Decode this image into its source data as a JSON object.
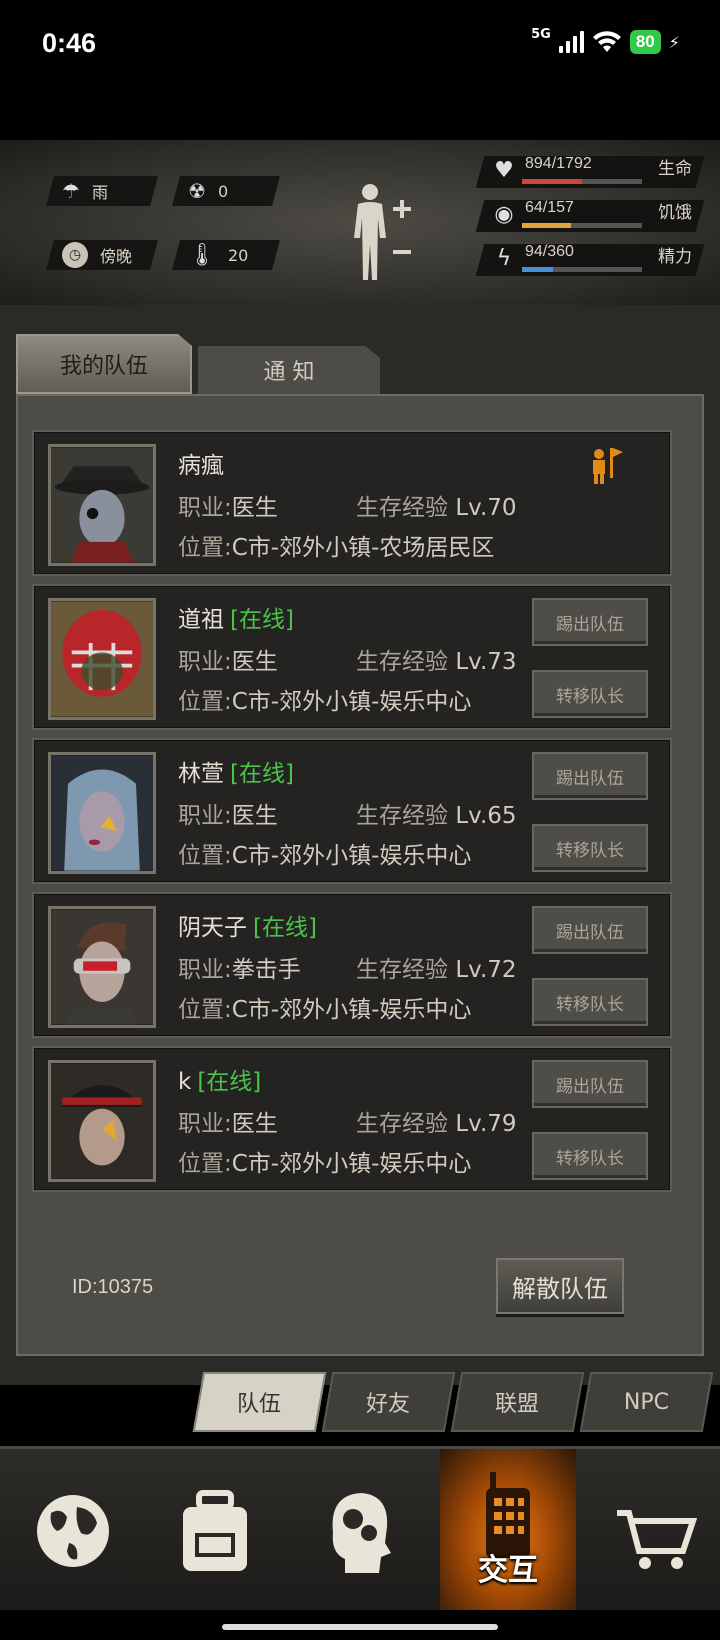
{
  "status_bar": {
    "time": "0:46",
    "network": "5G",
    "battery": "80"
  },
  "env": {
    "weather": "雨",
    "radiation": "0",
    "time_of_day": "傍晚",
    "temperature": "20"
  },
  "vitals": [
    {
      "label": "生命",
      "value": "894/1792",
      "fraction": 0.499,
      "color": "#d0453a"
    },
    {
      "label": "饥饿",
      "value": "64/157",
      "fraction": 0.408,
      "color": "#e0a63a"
    },
    {
      "label": "精力",
      "value": "94/360",
      "fraction": 0.261,
      "color": "#4a8fd6"
    }
  ],
  "tabs": {
    "mine": "我的队伍",
    "notice": "通 知"
  },
  "members": [
    {
      "name": "病瘋",
      "online": "",
      "job_label": "职业:",
      "job": "医生",
      "exp_label": "生存经验",
      "level": "Lv.70",
      "loc_label": "位置:",
      "location": "C市-郊外小镇-农场居民区",
      "is_leader": true
    },
    {
      "name": "道祖",
      "online": "[在线]",
      "job_label": "职业:",
      "job": "医生",
      "exp_label": "生存经验",
      "level": "Lv.73",
      "loc_label": "位置:",
      "location": "C市-郊外小镇-娱乐中心",
      "kick": "踢出队伍",
      "transfer": "转移队长"
    },
    {
      "name": "林萱",
      "online": "[在线]",
      "job_label": "职业:",
      "job": "医生",
      "exp_label": "生存经验",
      "level": "Lv.65",
      "loc_label": "位置:",
      "location": "C市-郊外小镇-娱乐中心",
      "kick": "踢出队伍",
      "transfer": "转移队长"
    },
    {
      "name": "阴天子",
      "online": "[在线]",
      "job_label": "职业:",
      "job": "拳击手",
      "exp_label": "生存经验",
      "level": "Lv.72",
      "loc_label": "位置:",
      "location": "C市-郊外小镇-娱乐中心",
      "kick": "踢出队伍",
      "transfer": "转移队长"
    },
    {
      "name": "k",
      "online": "[在线]",
      "job_label": "职业:",
      "job": "医生",
      "exp_label": "生存经验",
      "level": "Lv.79",
      "loc_label": "位置:",
      "location": "C市-郊外小镇-娱乐中心",
      "kick": "踢出队伍",
      "transfer": "转移队长"
    }
  ],
  "team_id": "ID:10375",
  "disband": "解散队伍",
  "subtabs": [
    "队伍",
    "好友",
    "联盟",
    "NPC"
  ],
  "bottom_nav": {
    "interact_label": "交互"
  }
}
